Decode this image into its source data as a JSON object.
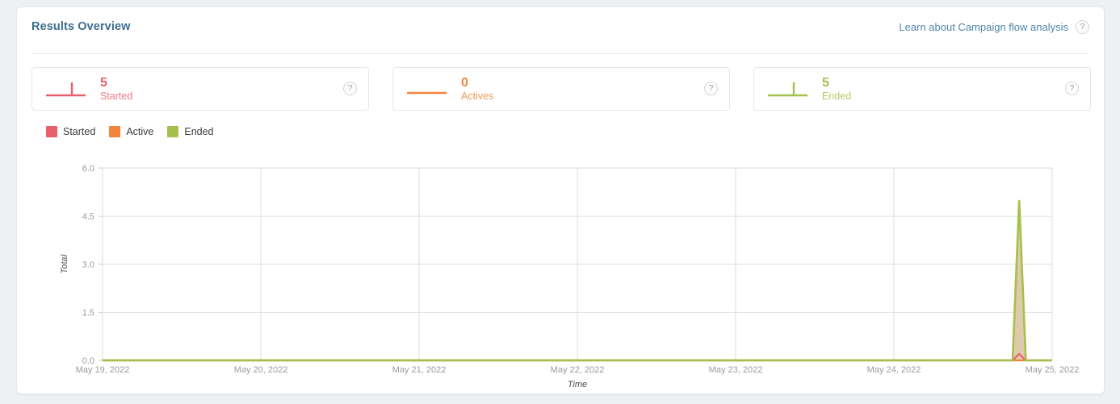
{
  "header": {
    "title": "Results Overview",
    "learn_link": "Learn about Campaign flow analysis",
    "help_icon": "question-mark-icon",
    "help_glyph": "?"
  },
  "colors": {
    "started": "#e8606b",
    "active": "#f2843c",
    "ended": "#a5c04b",
    "area_fill": "#ddc7a8",
    "title": "#3b6e8f",
    "link": "#4d86a8",
    "grid": "#dcdcdc",
    "panel_bg": "#ffffff",
    "page_bg": "#eff0f2"
  },
  "stat_cards": [
    {
      "value": "5",
      "label": "Started",
      "color": "#e8606b",
      "sparkline": "flat-with-spike",
      "help_glyph": "?"
    },
    {
      "value": "0",
      "label": "Actives",
      "color": "#f2843c",
      "sparkline": "flat",
      "help_glyph": "?"
    },
    {
      "value": "5",
      "label": "Ended",
      "color": "#a5c04b",
      "sparkline": "flat-with-spike",
      "help_glyph": "?"
    }
  ],
  "legend": {
    "items": [
      {
        "label": "Started",
        "color": "#e8606b"
      },
      {
        "label": "Active",
        "color": "#f2843c"
      },
      {
        "label": "Ended",
        "color": "#a5c04b"
      }
    ]
  },
  "chart_data": {
    "type": "area",
    "title": "",
    "xlabel": "Time",
    "ylabel": "Total",
    "grid": true,
    "legend_position": "top-left",
    "ylim": [
      0,
      6
    ],
    "yticks": [
      "0.0",
      "1.5",
      "3.0",
      "4.5",
      "6.0"
    ],
    "ytick_values": [
      0,
      1.5,
      3,
      4.5,
      6
    ],
    "xticks": [
      "May 19, 2022",
      "May 20, 2022",
      "May 21, 2022",
      "May 22, 2022",
      "May 23, 2022",
      "May 24, 2022",
      "May 25, 2022"
    ],
    "x": [
      "May 19, 2022",
      "May 20, 2022",
      "May 21, 2022",
      "May 22, 2022",
      "May 23, 2022",
      "May 24, 2022",
      "May 24, 2022 18:00",
      "May 24, 2022 19:00",
      "May 24, 2022 20:00",
      "May 25, 2022"
    ],
    "series": [
      {
        "name": "Started",
        "color": "#e8606b",
        "values": [
          0,
          0,
          0,
          0,
          0,
          0,
          0,
          0.2,
          0,
          0
        ]
      },
      {
        "name": "Active",
        "color": "#f2843c",
        "values": [
          0,
          0,
          0,
          0,
          0,
          0,
          0,
          0,
          0,
          0
        ]
      },
      {
        "name": "Ended",
        "color": "#a5c04b",
        "values": [
          0,
          0,
          0,
          0,
          0,
          0,
          0,
          5.0,
          0,
          0
        ]
      }
    ],
    "annotations": [
      "Single spike of 5 Ended events near May 24-25, 2022"
    ]
  }
}
